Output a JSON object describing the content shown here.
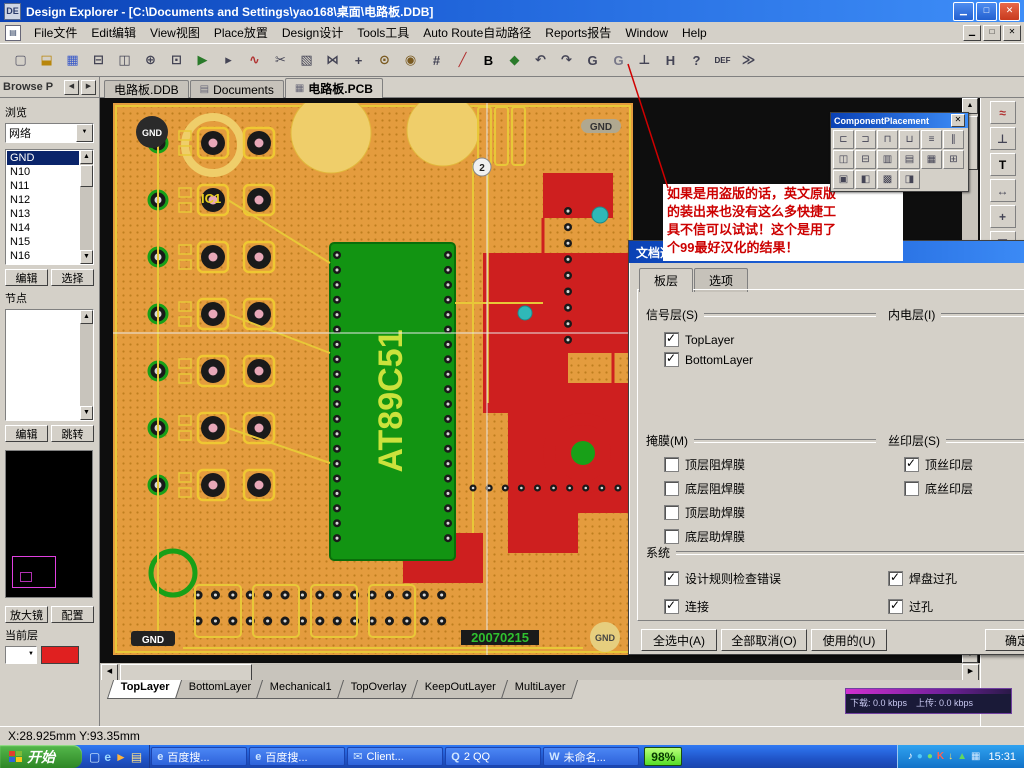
{
  "window": {
    "title": "Design Explorer - [C:\\Documents and Settings\\yao168\\桌面\\电路板.DDB]",
    "minimize_glyph": "▁",
    "restore_glyph": "□",
    "close_glyph": "✕"
  },
  "menu_items": [
    "File文件",
    "Edit编辑",
    "View视图",
    "Place放置",
    "Design设计",
    "Tools工具",
    "Auto Route自动路径",
    "Reports报告",
    "Window",
    "Help"
  ],
  "toolbar_icons": [
    {
      "name": "new-document-icon",
      "glyph": "▢",
      "color": "#556"
    },
    {
      "name": "open-icon",
      "glyph": "⬓",
      "color": "#B8860B"
    },
    {
      "name": "save-icon",
      "glyph": "▦",
      "color": "#3858C8"
    },
    {
      "name": "print-icon",
      "glyph": "⊟",
      "color": "#445"
    },
    {
      "name": "print-preview-icon",
      "glyph": "◫",
      "color": "#445"
    },
    {
      "name": "zoom-in-icon",
      "glyph": "⊕",
      "color": "#445"
    },
    {
      "name": "zoom-window-icon",
      "glyph": "⊡",
      "color": "#445"
    },
    {
      "name": "run-icon",
      "glyph": "▶",
      "color": "#2A7A2A"
    },
    {
      "name": "cursor-icon",
      "glyph": "▸",
      "color": "#445"
    },
    {
      "name": "wire-tool-icon",
      "glyph": "∿",
      "color": "#B03030"
    },
    {
      "name": "cut-icon",
      "glyph": "✂",
      "color": "#445"
    },
    {
      "name": "select-area-icon",
      "glyph": "▧",
      "color": "#445"
    },
    {
      "name": "net-tool-icon",
      "glyph": "⋈",
      "color": "#445"
    },
    {
      "name": "move-tool-icon",
      "glyph": "+",
      "color": "#445"
    },
    {
      "name": "via-tool-icon",
      "glyph": "⊙",
      "color": "#7A5A20"
    },
    {
      "name": "pad-tool-icon",
      "glyph": "◉",
      "color": "#7A5A20"
    },
    {
      "name": "grid-toggle-icon",
      "glyph": "#",
      "color": "#445"
    },
    {
      "name": "line-tool-icon",
      "glyph": "╱",
      "color": "#B03030"
    },
    {
      "name": "bold-text-icon",
      "glyph": "B",
      "color": "#000"
    },
    {
      "name": "polygon-tool-icon",
      "glyph": "◆",
      "color": "#2A7A2A"
    },
    {
      "name": "undo-icon",
      "glyph": "↶",
      "color": "#445"
    },
    {
      "name": "redo-icon",
      "glyph": "↷",
      "color": "#445"
    },
    {
      "name": "goto-prev-icon",
      "glyph": "G",
      "color": "#445"
    },
    {
      "name": "goto-next-icon",
      "glyph": "G",
      "color": "#778"
    },
    {
      "name": "ground-tool-icon",
      "glyph": "⊥",
      "color": "#445"
    },
    {
      "name": "h-tool-icon",
      "glyph": "H",
      "color": "#445"
    },
    {
      "name": "help-icon",
      "glyph": "?",
      "color": "#445"
    },
    {
      "name": "def-icon",
      "glyph": "DEF",
      "color": "#334"
    },
    {
      "name": "forward-icon",
      "glyph": "≫",
      "color": "#445"
    }
  ],
  "panel": {
    "header": "Browse P",
    "browse_label": "浏览",
    "browse_value": "网络",
    "nets": [
      "GND",
      "N10",
      "N11",
      "N12",
      "N13",
      "N14",
      "N15",
      "N16"
    ],
    "net_buttons": [
      "编辑",
      "选择"
    ],
    "nodes_label": "节点",
    "node_buttons": [
      "编辑",
      "跳转"
    ],
    "zoom_button": "放大镜",
    "config_button": "配置",
    "current_layer_label": "当前层"
  },
  "doc_tabs": [
    "电路板.DDB",
    "Documents",
    "电路板.PCB"
  ],
  "pcb": {
    "ic_label": "AT89C51",
    "ref_ic": "IC1",
    "gnd": "GND",
    "date": "20070215",
    "pad_label": "2"
  },
  "annotation": {
    "lines": [
      "如果是用盗版的话，英文原版",
      "的装出来也没有这么多快捷工",
      "具不信可以试试！这个是用了",
      "个99最好汉化的结果！"
    ]
  },
  "palette": {
    "title": "ComponentPlacement",
    "icons": [
      {
        "name": "align-left-icon",
        "glyph": "⊏"
      },
      {
        "name": "align-right-icon",
        "glyph": "⊐"
      },
      {
        "name": "align-top-icon",
        "glyph": "⊓"
      },
      {
        "name": "align-bottom-icon",
        "glyph": "⊔"
      },
      {
        "name": "distribute-horizontal-icon",
        "glyph": "≡"
      },
      {
        "name": "distribute-vertical-icon",
        "glyph": "∥"
      },
      {
        "name": "center-horizontal-icon",
        "glyph": "◫"
      },
      {
        "name": "center-vertical-icon",
        "glyph": "⊟"
      },
      {
        "name": "space-horizontal-icon",
        "glyph": "▥"
      },
      {
        "name": "space-vertical-icon",
        "glyph": "▤"
      },
      {
        "name": "arrange-within-room-icon",
        "glyph": "▦"
      },
      {
        "name": "arrange-within-rectangle-icon",
        "glyph": "⊞"
      },
      {
        "name": "move-to-grid-icon",
        "glyph": "▣"
      },
      {
        "name": "shove-icon",
        "glyph": "◧"
      },
      {
        "name": "placement-grid-icon",
        "glyph": "▩"
      },
      {
        "name": "align-center-icon",
        "glyph": "◨"
      }
    ]
  },
  "right_palette_icons": [
    {
      "name": "interactive-routing-icon",
      "glyph": "≈",
      "color": "#B03030"
    },
    {
      "name": "pad-place-icon",
      "glyph": "⊥",
      "color": "#445"
    },
    {
      "name": "text-tool-icon",
      "glyph": "T",
      "color": "#000"
    },
    {
      "name": "dimension-tool-icon",
      "glyph": "↔",
      "color": "#445"
    },
    {
      "name": "coordinate-tool-icon",
      "glyph": "+",
      "color": "#445"
    },
    {
      "name": "array-paste-icon",
      "glyph": "▦",
      "color": "#445"
    },
    {
      "name": "room-tool-icon",
      "glyph": "▭",
      "color": "#445"
    }
  ],
  "dialog": {
    "title": "文档选项",
    "tabs": [
      "板层",
      "选项"
    ],
    "groups": {
      "signal": "信号层(S)",
      "internal": "内电层(I)",
      "mask": "掩膜(M)",
      "silk": "丝印层(S)",
      "system": "系统"
    },
    "signal_items": [
      {
        "label": "TopLayer",
        "checked": true
      },
      {
        "label": "BottomLayer",
        "checked": true
      }
    ],
    "mask_items": [
      {
        "label": "顶层阻焊膜",
        "checked": false
      },
      {
        "label": "底层阻焊膜",
        "checked": false
      },
      {
        "label": "顶层助焊膜",
        "checked": false
      },
      {
        "label": "底层助焊膜",
        "checked": false
      }
    ],
    "silk_items": [
      {
        "label": "顶丝印层",
        "checked": true
      },
      {
        "label": "底丝印层",
        "checked": false
      }
    ],
    "system_items": [
      {
        "label": "设计规则检查错误",
        "checked": true
      },
      {
        "label": "连接",
        "checked": true
      },
      {
        "label": "焊盘过孔",
        "checked": true
      },
      {
        "label": "过孔",
        "checked": true
      }
    ],
    "buttons": [
      "全选中(A)",
      "全部取消(O)",
      "使用的(U)"
    ],
    "ok_button": "确定"
  },
  "layer_tabs": [
    "TopLayer",
    "BottomLayer",
    "Mechanical1",
    "TopOverlay",
    "KeepOutLayer",
    "MultiLayer"
  ],
  "statusbar": {
    "coords": "X:28.925mm Y:93.35mm"
  },
  "net_widget": {
    "download": "下载: 0.0 kbps",
    "upload": "上传: 0.0 kbps"
  },
  "taskbar": {
    "start": "开始",
    "tasks": [
      {
        "icon_glyph": "e",
        "label": "百度搜..."
      },
      {
        "icon_glyph": "e",
        "label": "百度搜..."
      },
      {
        "icon_glyph": "✉",
        "label": "Client..."
      },
      {
        "icon_glyph": "Q",
        "label": "2 QQ"
      },
      {
        "icon_glyph": "W",
        "label": "未命名..."
      }
    ],
    "battery": "98%",
    "clock": "15:31"
  },
  "quick_icons": [
    {
      "name": "show-desktop-icon",
      "glyph": "▢",
      "color": "#CFE8FF"
    },
    {
      "name": "ie-quick-icon",
      "glyph": "e",
      "color": "#9CD8FF"
    },
    {
      "name": "media-player-quick-icon",
      "glyph": "►",
      "color": "#FFB33C"
    },
    {
      "name": "folder-quick-icon",
      "glyph": "▤",
      "color": "#FFE28A"
    }
  ],
  "tray_icons": [
    {
      "name": "volume-tray-icon",
      "glyph": "♪",
      "color": "#FFFFFF"
    },
    {
      "name": "qq-tray-icon",
      "glyph": "●",
      "color": "#50C8FF"
    },
    {
      "name": "messenger-tray-icon",
      "glyph": "●",
      "color": "#70E070"
    },
    {
      "name": "kaspersky-tray-icon",
      "glyph": "K",
      "color": "#FF6050"
    },
    {
      "name": "download-tray-icon",
      "glyph": "↓",
      "color": "#FFE060"
    },
    {
      "name": "antivirus-tray-icon",
      "glyph": "▲",
      "color": "#60D860"
    },
    {
      "name": "network-tray-icon",
      "glyph": "▦",
      "color": "#D0E8FF"
    }
  ]
}
